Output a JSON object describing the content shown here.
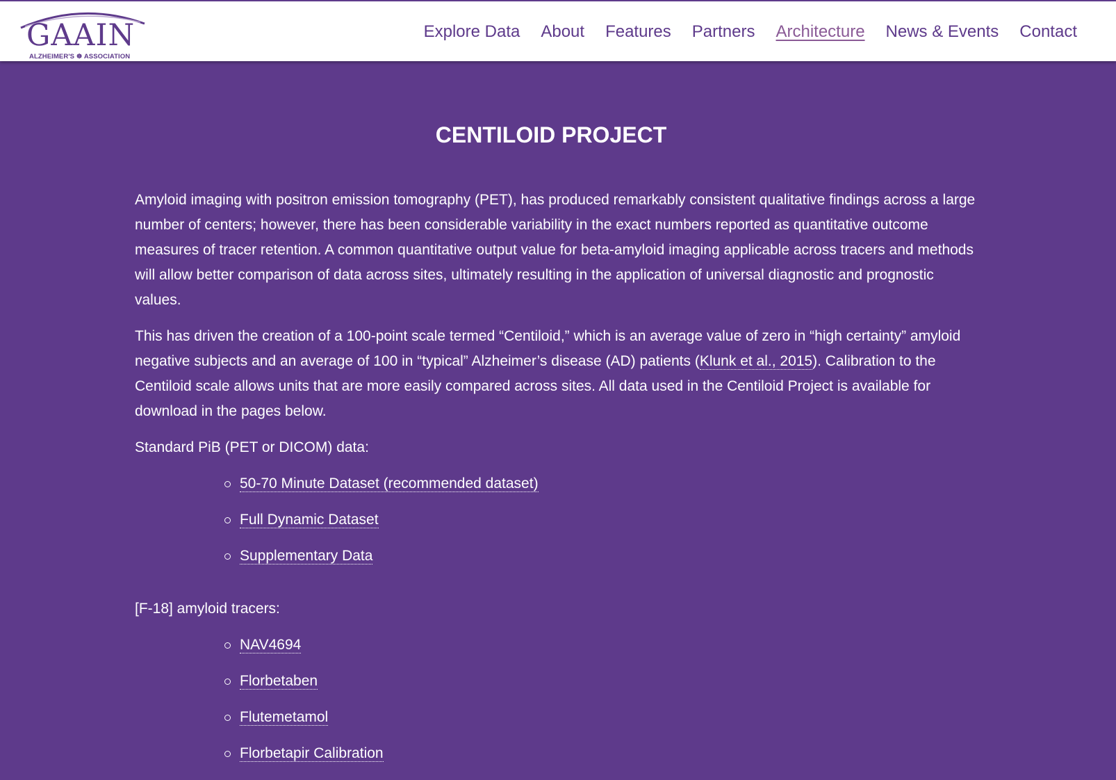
{
  "logo": {
    "wordmark": "GAAIN",
    "subtitle": "ALZHEIMER'S ☸ ASSOCIATION"
  },
  "nav": {
    "items": [
      {
        "label": "Explore Data",
        "active": false
      },
      {
        "label": "About",
        "active": false
      },
      {
        "label": "Features",
        "active": false
      },
      {
        "label": "Partners",
        "active": false
      },
      {
        "label": "Architecture",
        "active": true
      },
      {
        "label": "News & Events",
        "active": false
      },
      {
        "label": "Contact",
        "active": false
      }
    ]
  },
  "page": {
    "title": "CENTILOID PROJECT",
    "intro": "Amyloid imaging with positron emission tomography (PET), has produced remarkably consistent qualitative findings across a large number of centers; however, there has been considerable variability in the exact numbers reported as quantitative outcome measures of tracer retention. A common quantitative output value for beta-amyloid imaging applicable across tracers and methods will allow better comparison of data across sites, ultimately resulting in the application of universal diagnostic and prognostic values.",
    "para2_before": "This has driven the creation of a 100-point scale termed “Centiloid,” which is an average value of zero in “high certainty” amyloid negative subjects and an average of 100 in “typical” Alzheimer’s disease (AD) patients (",
    "para2_link": "Klunk et al., 2015",
    "para2_after": "). Calibration to the Centiloid scale allows units that are more easily compared across sites. All data used in the Centiloid Project is available for download in the pages below.",
    "pib_heading": "Standard PiB (PET or DICOM) data:",
    "pib_links": [
      "50-70 Minute Dataset (recommended dataset)",
      "Full Dynamic Dataset",
      "Supplementary Data"
    ],
    "f18_heading": "[F-18] amyloid tracers:",
    "f18_links": [
      "NAV4694",
      "Florbetaben",
      "Flutemetamol",
      "Florbetapir Calibration"
    ]
  },
  "colors": {
    "brand_purple": "#5e3a8b",
    "active_nav": "#8a5a96",
    "text_on_purple": "#ffffff"
  }
}
